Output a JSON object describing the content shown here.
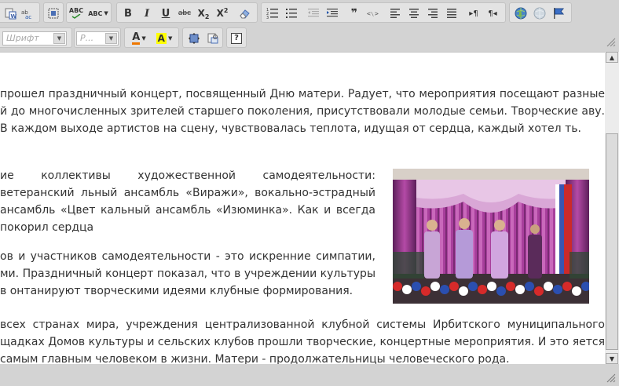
{
  "toolbar1": {
    "subscript_label": "X",
    "subscript_mark": "2",
    "superscript_label": "X",
    "superscript_mark": "2",
    "spell_label": "ABC",
    "autospell_label": "ABC",
    "strike_label": "abc",
    "quote_label": "❞",
    "bold_label": "B",
    "italic_label": "I",
    "underline_label": "U"
  },
  "toolbar2": {
    "font_placeholder": "Шрифт",
    "size_placeholder": "Р...",
    "text_color_label": "A",
    "bg_color_label": "A",
    "help_label": "?"
  },
  "colors": {
    "accent_bg": "#ffff00",
    "text_color": "#ee7700"
  },
  "content": {
    "p1": "прошел праздничный концерт, посвященный Дню матери. Радует, что мероприятия посещают разные й до многочисленных зрителей старшего поколения, присутствовали молодые семьи. Творческие аву. В каждом выходе артистов на сцену, чувствовалась теплота, идущая от сердца, каждый хотел ть.",
    "p2": "ие коллективы художественной самодеятельности: ветеранский льный ансамбль «Виражи», вокально-эстрадный ансамбль «Цвет кальный ансамбль «Изюминка». Как и всегда покорил сердца",
    "p3": "ов и участников самодеятельности - это искренние симпатии, ми. Праздничный концерт показал, что в учреждении культуры в онтанируют творческими идеями клубные формирования.",
    "p4": "всех странах мира, учреждения централизованной клубной системы Ирбитского муниципального щадках Домов культуры и сельских клубов прошли творческие, концертные мероприятия. И это яется самым главным человеком в жизни. Матери - продолжательницы человеческого рода."
  }
}
